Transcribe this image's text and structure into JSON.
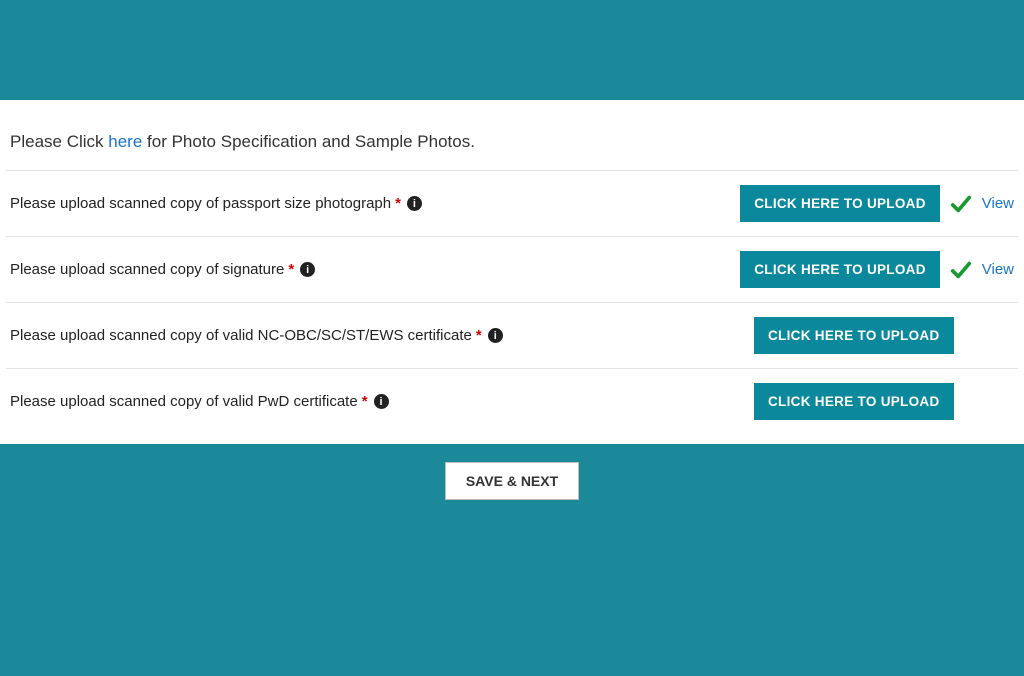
{
  "spec": {
    "prefix": "Please Click ",
    "link": "here",
    "suffix": " for Photo Specification and Sample Photos."
  },
  "rows": [
    {
      "label": "Please upload scanned copy of passport size photograph",
      "button": "CLICK HERE TO UPLOAD",
      "uploaded": true,
      "view": "View"
    },
    {
      "label": "Please upload scanned copy of signature",
      "button": "CLICK HERE TO UPLOAD",
      "uploaded": true,
      "view": "View"
    },
    {
      "label": "Please upload scanned copy of valid NC-OBC/SC/ST/EWS certificate",
      "button": "CLICK HERE TO UPLOAD",
      "uploaded": false
    },
    {
      "label": "Please upload scanned copy of valid PwD certificate",
      "button": "CLICK HERE TO UPLOAD",
      "uploaded": false
    }
  ],
  "footer": {
    "save": "SAVE & NEXT"
  },
  "required_marker": "*",
  "info_glyph": "i"
}
